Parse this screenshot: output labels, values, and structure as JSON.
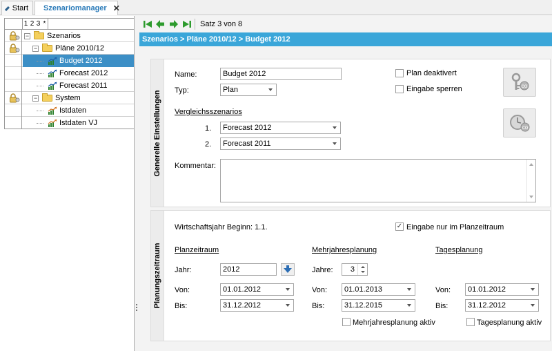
{
  "tabs": [
    {
      "label": "Start",
      "active": false
    },
    {
      "label": "Szenariomanager",
      "active": true
    }
  ],
  "tree": {
    "header_columns": [
      "1",
      "2",
      "3",
      "*"
    ],
    "items": [
      {
        "label": "Szenarios",
        "type": "folder",
        "level": 0,
        "locked": true,
        "expanded": true
      },
      {
        "label": "Pläne 2010/12",
        "type": "folder",
        "level": 1,
        "locked": true,
        "expanded": true
      },
      {
        "label": "Budget 2012",
        "type": "scenario",
        "level": 2,
        "locked": false,
        "selected": true
      },
      {
        "label": "Forecast 2012",
        "type": "scenario",
        "level": 2,
        "locked": false
      },
      {
        "label": "Forecast 2011",
        "type": "scenario",
        "level": 2,
        "locked": false
      },
      {
        "label": "System",
        "type": "folder",
        "level": 1,
        "locked": true,
        "expanded": true
      },
      {
        "label": "Istdaten",
        "type": "scenario",
        "level": 2,
        "locked": false
      },
      {
        "label": "Istdaten VJ",
        "type": "scenario",
        "level": 2,
        "locked": false
      }
    ]
  },
  "nav": {
    "record_text": "Satz 3 von 8",
    "buttons": [
      "first-record-icon",
      "prev-record-icon",
      "next-record-icon",
      "last-record-icon"
    ]
  },
  "breadcrumb": "Szenarios > Pläne 2010/12 > Budget 2012",
  "general": {
    "section_title": "Generelle Einstellungen",
    "name_label": "Name:",
    "name_value": "Budget 2012",
    "type_label": "Typ:",
    "type_value": "Plan",
    "plan_disabled_label": "Plan deaktivert",
    "plan_disabled_checked": false,
    "lock_input_label": "Eingabe sperren",
    "lock_input_checked": false,
    "comparison_label": "Vergleichsszenarios",
    "comparison": [
      {
        "index": "1.",
        "value": "Forecast 2012"
      },
      {
        "index": "2.",
        "value": "Forecast 2011"
      }
    ],
    "comment_label": "Kommentar:",
    "comment_value": "",
    "buttons": [
      "keys-icon",
      "clock-icon"
    ]
  },
  "planning": {
    "section_title": "Planungszeitraum",
    "fiscal_year_text": "Wirtschaftsjahr Beginn: 1.1.",
    "only_in_period_label": "Eingabe nur im Planzeitraum",
    "only_in_period_checked": true,
    "plan_period": {
      "title": "Planzeitraum",
      "year_label": "Jahr:",
      "year_value": "2012",
      "from_label": "Von:",
      "from_value": "01.01.2012",
      "to_label": "Bis:",
      "to_value": "31.12.2012"
    },
    "multi_year": {
      "title": "Mehrjahresplanung",
      "years_label": "Jahre:",
      "years_value": "3",
      "from_label": "Von:",
      "from_value": "01.01.2013",
      "to_label": "Bis:",
      "to_value": "31.12.2015",
      "active_label": "Mehrjahresplanung aktiv",
      "active_checked": false
    },
    "daily": {
      "title": "Tagesplanung",
      "from_label": "Von:",
      "from_value": "01.01.2012",
      "to_label": "Bis:",
      "to_value": "31.12.2012",
      "active_label": "Tagesplanung aktiv",
      "active_checked": false
    }
  },
  "colors": {
    "breadcrumb_bg": "#3aa6d9",
    "selection_bg": "#3c8fc6",
    "nav_green": "#2e9b2e",
    "folder": "#f4cf5c"
  }
}
